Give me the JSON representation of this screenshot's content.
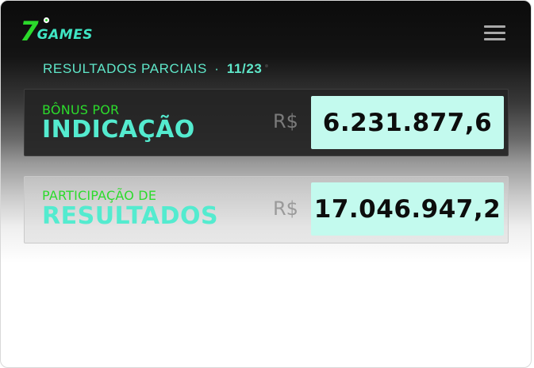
{
  "brand": {
    "seven": "7",
    "name": "GAMES"
  },
  "header": {
    "subtitle": "RESULTADOS PARCIAIS",
    "separator": "·",
    "date": "11/23"
  },
  "cards": [
    {
      "label_top": "BÔNUS POR",
      "label_big": "INDICAÇÃO",
      "currency": "R$",
      "value": "6.231.877,6"
    },
    {
      "label_top": "PARTICIPAÇÃO DE",
      "label_big": "RESULTADOS",
      "currency": "R$",
      "value": "17.046.947,2"
    }
  ],
  "colors": {
    "accent_green": "#2cdb2c",
    "accent_teal": "#54ebcf",
    "value_box": "#c3faee",
    "background_dark": "#0b0b0b"
  },
  "icons": {
    "menu": "hamburger-menu-icon"
  }
}
